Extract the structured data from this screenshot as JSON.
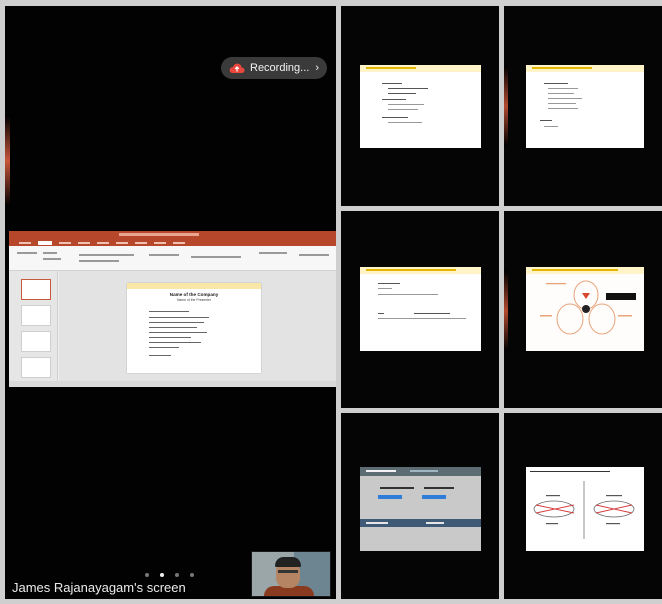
{
  "meeting": {
    "recording_label": "Recording...",
    "recording_chevron": "›",
    "shared_screen_label": "James Rajanayagam's screen",
    "page_dots": 4,
    "active_dot": 1
  },
  "icons": {
    "recording": "cloud-upload-icon",
    "more": "chevron-right-icon"
  },
  "shared_slide": {
    "title": "Name of the Company",
    "subtitle": "Name of the Presenter"
  },
  "colors": {
    "powerpoint_accent": "#b7472a",
    "recording_pill": "#3a3a3a",
    "slide_header": "#fff4c8"
  },
  "tiles": [
    "participant-tile-1",
    "participant-tile-2",
    "participant-tile-3",
    "participant-tile-4",
    "participant-tile-5",
    "participant-tile-6"
  ]
}
